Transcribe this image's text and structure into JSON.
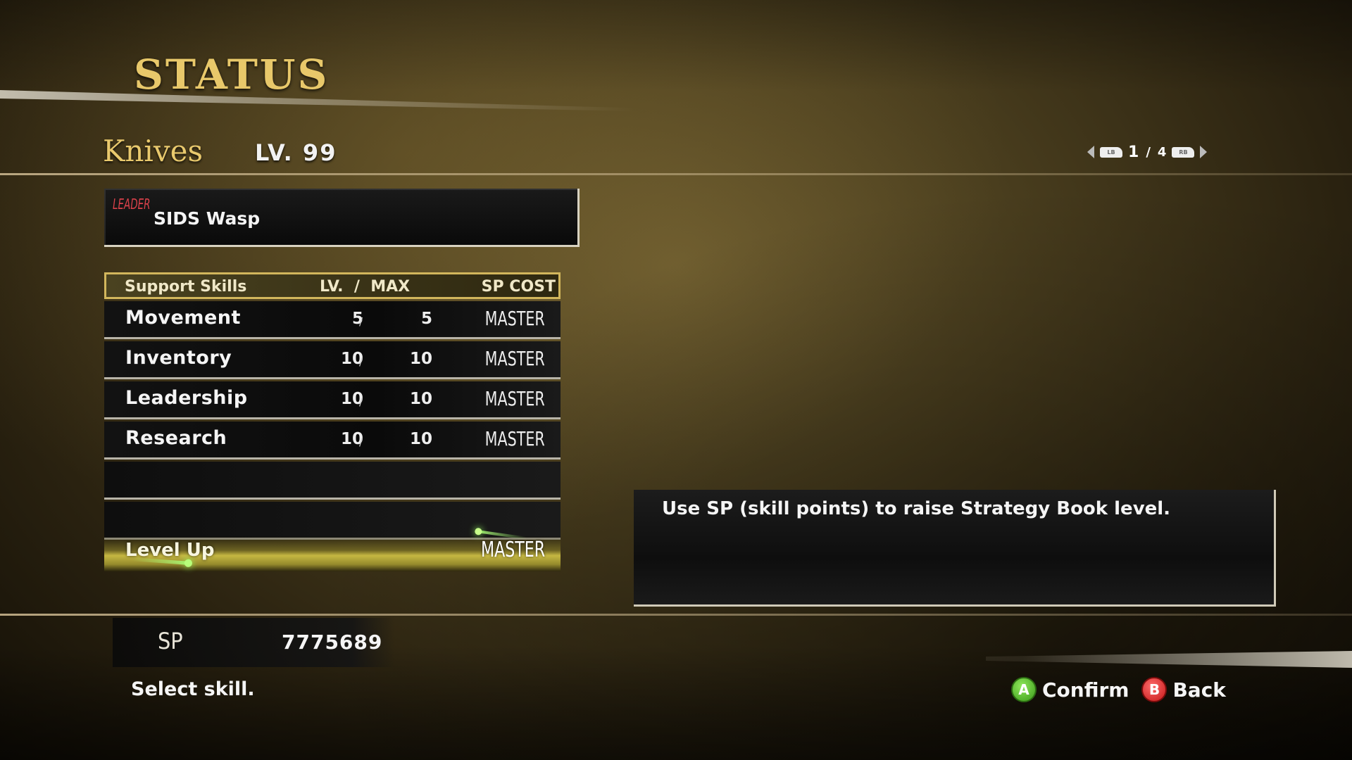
{
  "header": {
    "title": "STATUS"
  },
  "character": {
    "name": "Knives",
    "level": "LV. 99"
  },
  "pager": {
    "current": "1",
    "total": "4",
    "separator": "/",
    "left_button": "LB",
    "right_button": "RB"
  },
  "leader": {
    "tag": "LEADER",
    "name": "SIDS Wasp"
  },
  "skills_table": {
    "headers": {
      "skill": "Support Skills",
      "lvmax": "LV.  /  MAX",
      "sp_cost": "SP COST"
    },
    "rows": [
      {
        "name": "Movement",
        "lv": "5",
        "max": "5",
        "cost": "MASTER"
      },
      {
        "name": "Inventory",
        "lv": "10",
        "max": "10",
        "cost": "MASTER"
      },
      {
        "name": "Leadership",
        "lv": "10",
        "max": "10",
        "cost": "MASTER"
      },
      {
        "name": "Research",
        "lv": "10",
        "max": "10",
        "cost": "MASTER"
      }
    ],
    "level_up": {
      "name": "Level Up",
      "cost": "MASTER"
    }
  },
  "description": "Use SP (skill points) to raise Strategy Book level.",
  "sp": {
    "label": "SP",
    "value": "7775689"
  },
  "hint": "Select skill.",
  "controls": {
    "confirm": {
      "button": "A",
      "label": "Confirm",
      "color": "#4caf2a"
    },
    "back": {
      "button": "B",
      "label": "Back",
      "color": "#d42020"
    }
  }
}
